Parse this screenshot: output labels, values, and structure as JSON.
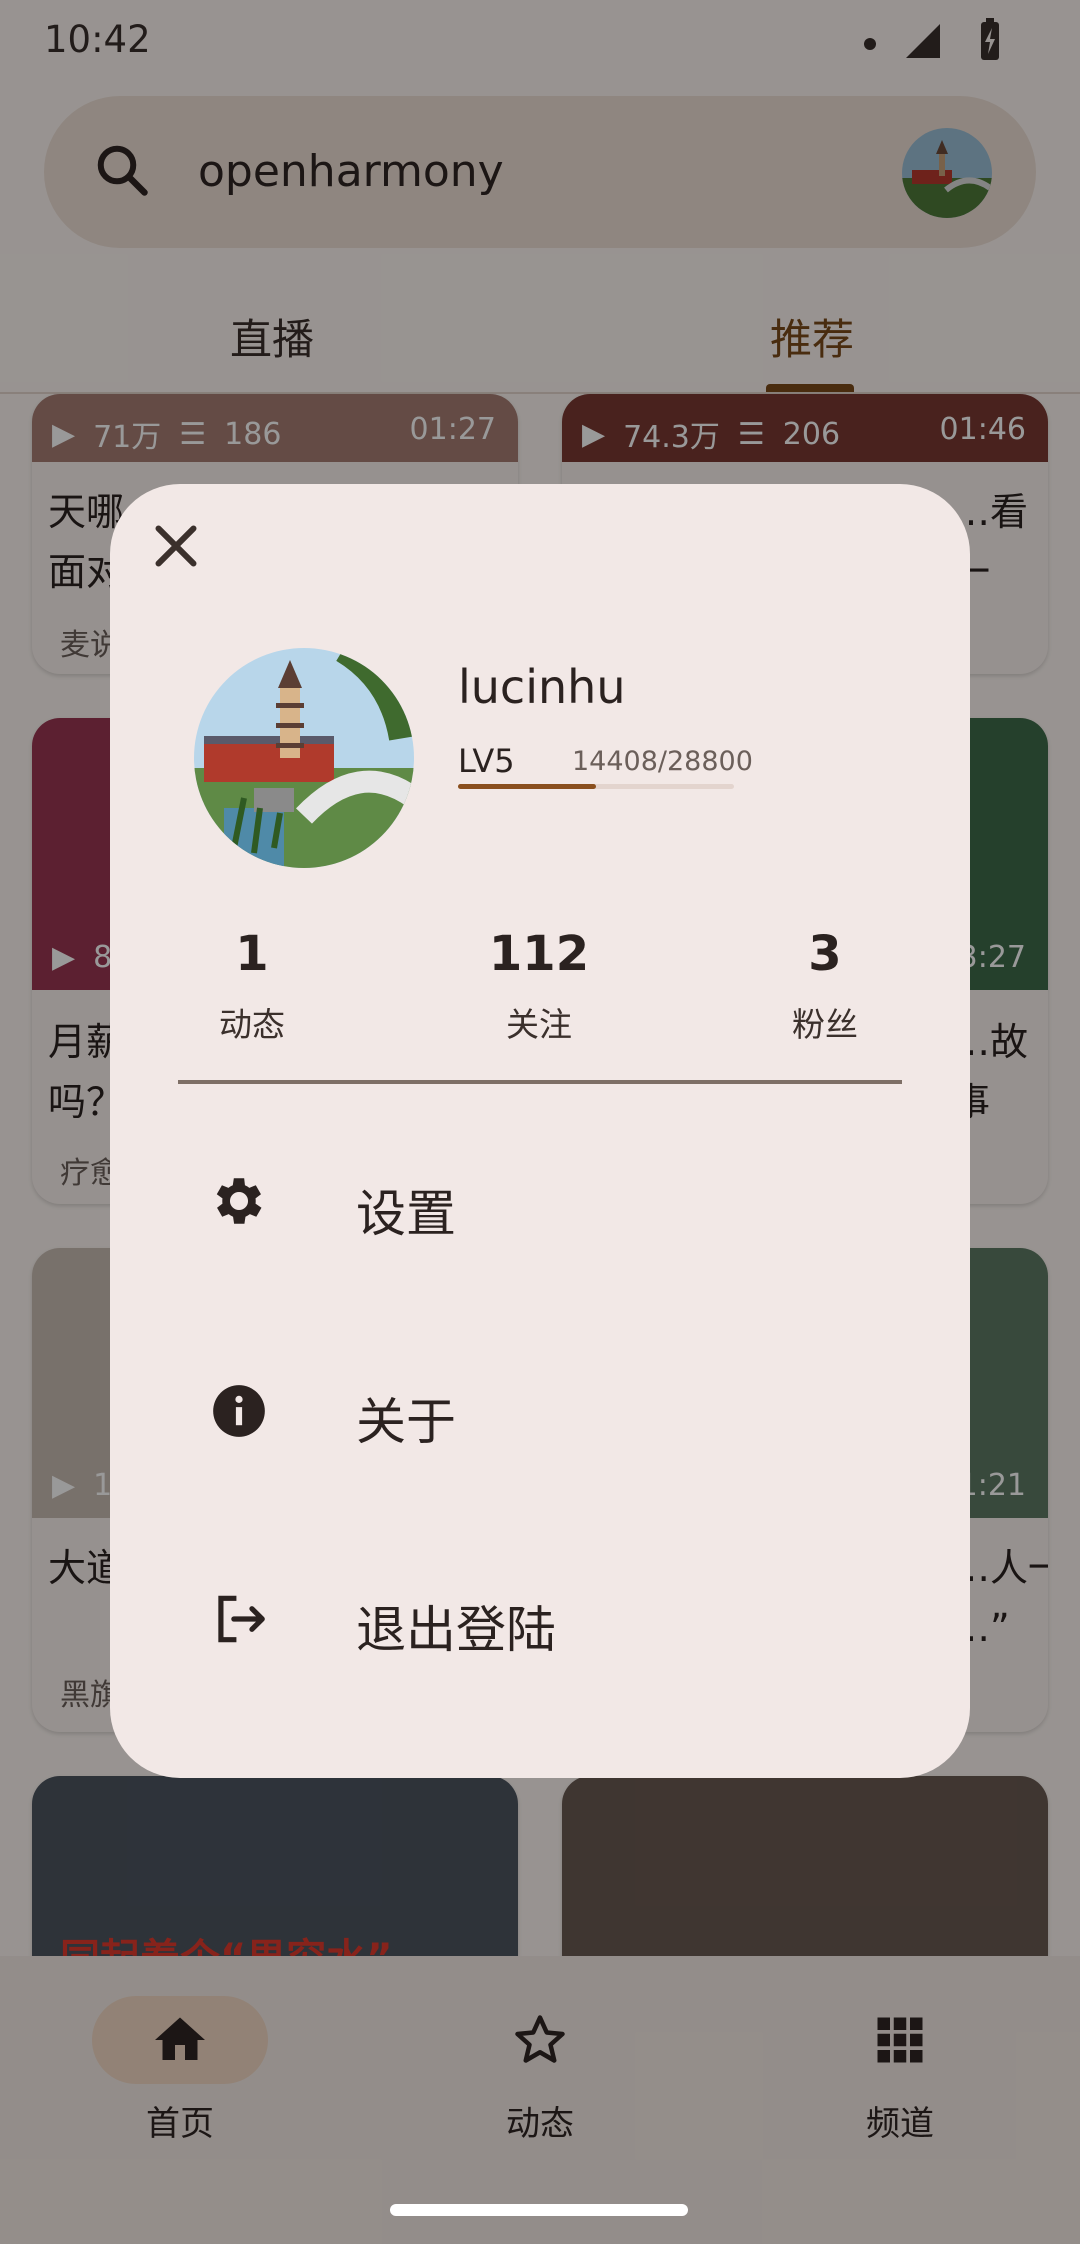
{
  "status_bar": {
    "time": "10:42"
  },
  "search": {
    "query": "openharmony"
  },
  "tabs": [
    {
      "label": "直播"
    },
    {
      "label": "推荐"
    }
  ],
  "cards": [
    {
      "views": "71万",
      "comments": "186",
      "duration": "01:27",
      "title": "天哪…\n面对…",
      "author": "麦说…"
    },
    {
      "views": "74.3万",
      "comments": "206",
      "duration": "01:46",
      "title": "…看一",
      "author": ""
    },
    {
      "views": "8…",
      "comments": "",
      "duration": "",
      "title": "月薪…\n吗？…",
      "author": "疗愈…"
    },
    {
      "views": "",
      "comments": "",
      "duration": "…3:27",
      "title": "…故事",
      "author": ""
    },
    {
      "views": "1…",
      "comments": "",
      "duration": "",
      "title": "大道…",
      "author": "黑旗…"
    },
    {
      "views": "",
      "comments": "",
      "duration": "…1:21",
      "title": "…人一\n…”",
      "author": ""
    },
    {
      "caption": "同起着个“果穷水”"
    }
  ],
  "bottom_nav": [
    {
      "label": "首页"
    },
    {
      "label": "动态"
    },
    {
      "label": "频道"
    }
  ],
  "dialog": {
    "username": "lucinhu",
    "level": "LV5",
    "xp_text": "14408/28800",
    "xp_progress": 0.5,
    "stats": [
      {
        "value": "1",
        "label": "动态"
      },
      {
        "value": "112",
        "label": "关注"
      },
      {
        "value": "3",
        "label": "粉丝"
      }
    ],
    "menu": [
      {
        "label": "设置",
        "icon": "gear-icon"
      },
      {
        "label": "关于",
        "icon": "info-icon"
      },
      {
        "label": "退出登陆",
        "icon": "logout-icon"
      }
    ]
  },
  "colors": {
    "accent": "#7b4a1a",
    "dialog_bg": "#f2e8e6",
    "nav_pill": "#f3d9c5"
  }
}
